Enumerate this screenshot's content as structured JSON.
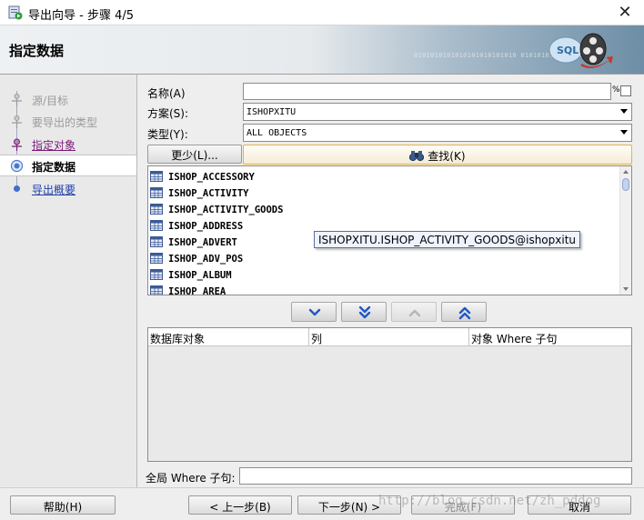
{
  "window": {
    "title": "导出向导 - 步骤 4/5",
    "icon": "app-export-icon",
    "close_glyph": "✕"
  },
  "header": {
    "title": "指定数据",
    "binary_text": "0101010101010101010101010 01010101010101010",
    "logo_text": "SQL"
  },
  "steps": [
    {
      "label": "源/目标",
      "state": "done"
    },
    {
      "label": "要导出的类型",
      "state": "done"
    },
    {
      "label": "指定对象",
      "state": "visited"
    },
    {
      "label": "指定数据",
      "state": "active"
    },
    {
      "label": "导出概要",
      "state": "link"
    }
  ],
  "form": {
    "name_label": "名称(A)",
    "name_value": "",
    "name_suffix": "%",
    "schema_label": "方案(S):",
    "schema_value": "ISHOPXITU",
    "type_label": "类型(Y):",
    "type_value": "ALL OBJECTS",
    "less_button": "更少(L)...",
    "find_button": "查找(K)"
  },
  "objects": [
    "ISHOP_ACCESSORY",
    "ISHOP_ACTIVITY",
    "ISHOP_ACTIVITY_GOODS",
    "ISHOP_ADDRESS",
    "ISHOP_ADVERT",
    "ISHOP_ADV_POS",
    "ISHOP_ALBUM",
    "ISHOP_AREA"
  ],
  "tooltip": "ISHOPXITU.ISHOP_ACTIVITY_GOODS@ishopxitu",
  "move_buttons": [
    {
      "icon": "chevron-down-icon",
      "enabled": true
    },
    {
      "icon": "double-chevron-down-icon",
      "enabled": true
    },
    {
      "icon": "chevron-up-icon",
      "enabled": false
    },
    {
      "icon": "double-chevron-up-icon",
      "enabled": true
    }
  ],
  "grid": {
    "columns": [
      "数据库对象",
      "列",
      "对象 Where 子句"
    ],
    "rows": []
  },
  "global_where": {
    "label": "全局 Where 子句:",
    "value": ""
  },
  "buttons": {
    "help": "帮助(H)",
    "back": "< 上一步(B)",
    "next": "下一步(N) >",
    "finish": "完成(F)",
    "cancel": "取消"
  },
  "watermark": "http://blog.csdn.net/zh_pddog"
}
